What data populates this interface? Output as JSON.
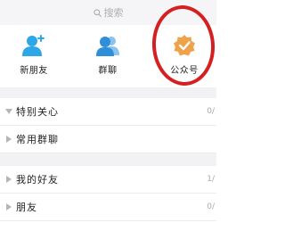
{
  "search": {
    "placeholder": "搜索",
    "icon": "search-icon"
  },
  "shortcuts": [
    {
      "label": "新朋友",
      "icon": "add-person-icon",
      "color": "#2ea7e8"
    },
    {
      "label": "群聊",
      "icon": "group-chat-icon",
      "color": "#2e8fd8"
    },
    {
      "label": "公众号",
      "icon": "official-account-badge-icon",
      "color": "#f0a24a"
    }
  ],
  "groups": [
    {
      "name": "特别关心",
      "expanded": true,
      "count": "0/"
    },
    {
      "name": "常用群聊",
      "expanded": false,
      "count": ""
    },
    {
      "name": "我的好友",
      "expanded": false,
      "count": "1/"
    },
    {
      "name": "朋友",
      "expanded": false,
      "count": "0/"
    }
  ],
  "colors": {
    "highlight_ring": "#d42020",
    "section_gap": "#f2f2f4",
    "search_bg": "#f5f5f7"
  }
}
